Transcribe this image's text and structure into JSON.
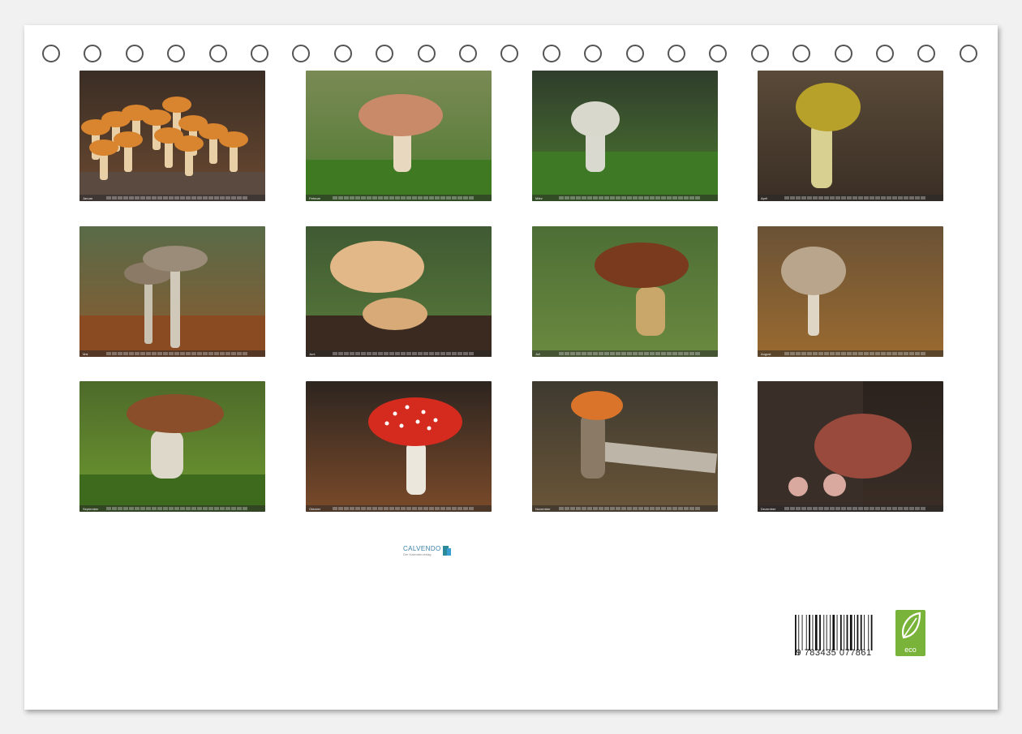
{
  "rings_count": 23,
  "months": [
    {
      "label": "Januar",
      "scene": "cluster-orange"
    },
    {
      "label": "Februar",
      "scene": "pink-cap-moss"
    },
    {
      "label": "März",
      "scene": "white-puffball"
    },
    {
      "label": "April",
      "scene": "yellow-scaly"
    },
    {
      "label": "Mai",
      "scene": "brown-pair"
    },
    {
      "label": "Juni",
      "scene": "funnel-beige"
    },
    {
      "label": "Juli",
      "scene": "bolete-grass"
    },
    {
      "label": "August",
      "scene": "shaggy-parasol"
    },
    {
      "label": "September",
      "scene": "porcini-moss"
    },
    {
      "label": "Oktober",
      "scene": "fly-agaric"
    },
    {
      "label": "November",
      "scene": "orange-birch-bolete"
    },
    {
      "label": "Dezember",
      "scene": "jelly-ear"
    }
  ],
  "publisher": {
    "name": "CALVENDO",
    "tagline": "Der Kalenderverlag"
  },
  "isbn": {
    "digits": "9 783435 077861"
  },
  "eco_badge": {
    "label": "eco"
  },
  "colors": {
    "eco_green": "#7ab33a",
    "brand_blue": "#3a7fa8"
  }
}
